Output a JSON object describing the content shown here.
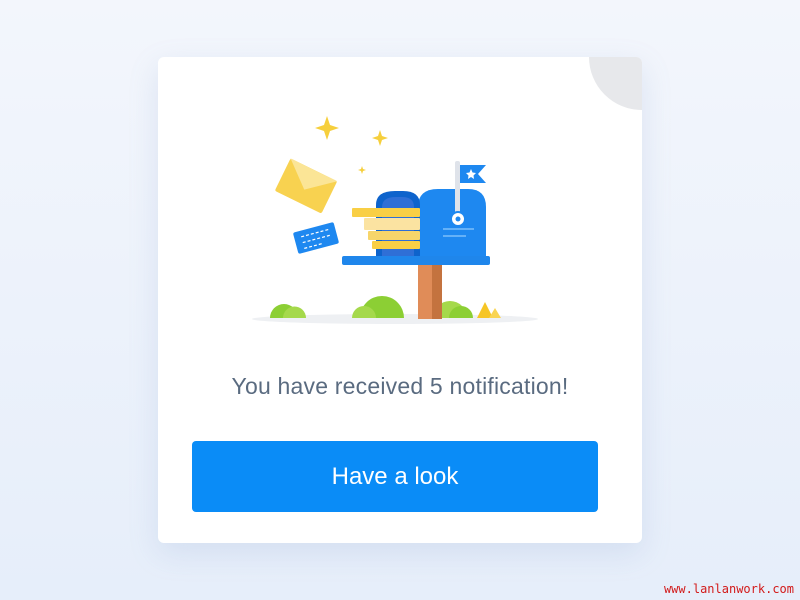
{
  "dialog": {
    "message": "You have received 5 notification!",
    "button_label": "Have a look",
    "close_icon": "close-icon",
    "illustration": "mailbox-with-letters"
  },
  "colors": {
    "accent": "#0a8cf7",
    "message_text": "#5a6b80",
    "close_badge": "#e7e8eb",
    "mailbox_blue": "#1e88f0",
    "envelope_yellow": "#f8d250",
    "foliage_green": "#8ccf34"
  },
  "watermark": "www.lanlanwork.com"
}
